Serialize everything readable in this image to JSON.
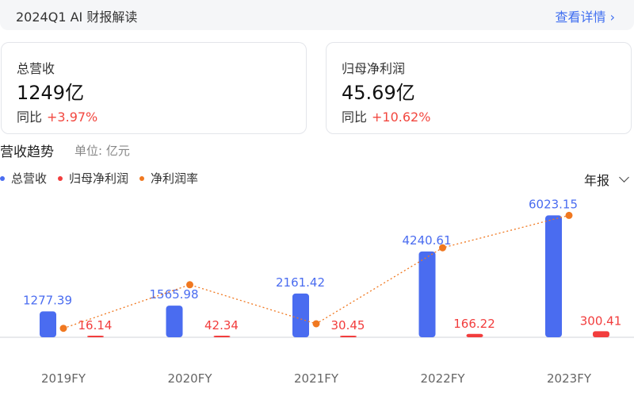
{
  "banner": {
    "title": "2024Q1 AI 财报解读",
    "link": "查看详情 ›"
  },
  "cards": [
    {
      "label": "总营收",
      "value": "1249亿",
      "yoy_label": "同比",
      "yoy": "+3.97%"
    },
    {
      "label": "归母净利润",
      "value": "45.69亿",
      "yoy_label": "同比",
      "yoy": "+10.62%"
    }
  ],
  "section": {
    "title": "营收趋势",
    "unit": "单位: 亿元",
    "period": "年报"
  },
  "colors": {
    "revenue": "#4a6cf0",
    "profit": "#f23d3d",
    "margin": "#f07820",
    "link": "#3f6ef0"
  },
  "chart_data": {
    "type": "bar",
    "categories": [
      "2019FY",
      "2020FY",
      "2021FY",
      "2022FY",
      "2023FY"
    ],
    "series": [
      {
        "name": "总营收",
        "kind": "bar",
        "values": [
          1277.39,
          1565.98,
          2161.42,
          4240.61,
          6023.15
        ]
      },
      {
        "name": "归母净利润",
        "kind": "bar",
        "values": [
          16.14,
          42.34,
          30.45,
          166.22,
          300.41
        ]
      },
      {
        "name": "净利润率",
        "kind": "line",
        "values": [
          1.26,
          2.7,
          1.41,
          3.92,
          4.99
        ]
      }
    ],
    "legend": "top-left",
    "grid": false
  }
}
